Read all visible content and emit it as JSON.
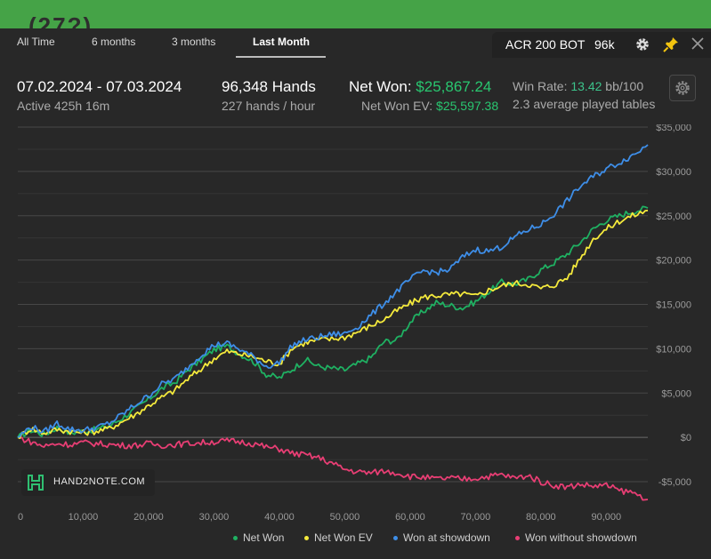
{
  "top": {
    "partial_text": "(27?)"
  },
  "tabs": [
    {
      "label": "All Time",
      "active": false
    },
    {
      "label": "6 months",
      "active": false
    },
    {
      "label": "3 months",
      "active": false
    },
    {
      "label": "Last Month",
      "active": true
    }
  ],
  "bot": {
    "name": "ACR 200 BOT",
    "hands": "96k",
    "gear": "gear-icon",
    "pin": "pin-icon",
    "close": "close-icon"
  },
  "stats": {
    "date_range": "07.02.2024 - 07.03.2024",
    "active": "Active 425h 16m",
    "hands": "96,348 Hands",
    "hands_per_hour": "227 hands / hour",
    "net_won_label": "Net Won:",
    "net_won_value": "$25,867.24",
    "net_won_ev_label": "Net Won  EV:",
    "net_won_ev_value": "$25,597.38",
    "win_rate_label": "Win Rate:",
    "win_rate_value": "13.42",
    "win_rate_unit": "bb/100",
    "tables": "2.3 average played tables"
  },
  "watermark": {
    "text": "HAND2NOTE.COM"
  },
  "colors": {
    "net_won": "#1fb162",
    "net_won_ev": "#f5ea3c",
    "showdown": "#3e8ee8",
    "no_showdown": "#e83e74",
    "header_green": "#45a347"
  },
  "chart_data": {
    "type": "line",
    "x_ticks": [
      "0",
      "10,000",
      "20,000",
      "30,000",
      "40,000",
      "50,000",
      "60,000",
      "70,000",
      "80,000",
      "90,000"
    ],
    "y_ticks": [
      "$35,000",
      "$30,000",
      "$25,000",
      "$20,000",
      "$15,000",
      "$10,000",
      "$5,000",
      "$0",
      "-$5,000"
    ],
    "xlim": [
      0,
      96348
    ],
    "ylim": [
      -7500,
      35000
    ],
    "grid": true,
    "legend_position": "bottom-right",
    "series": [
      {
        "name": "Net Won",
        "color": "#1fb162",
        "x": [
          0,
          2000,
          4000,
          6000,
          8000,
          10000,
          12000,
          14000,
          16000,
          18000,
          20000,
          22000,
          24000,
          26000,
          28000,
          30000,
          32000,
          34000,
          36000,
          38000,
          40000,
          42000,
          44000,
          46000,
          48000,
          50000,
          52000,
          54000,
          56000,
          58000,
          60000,
          62000,
          64000,
          66000,
          68000,
          70000,
          72000,
          74000,
          76000,
          78000,
          80000,
          82000,
          84000,
          86000,
          88000,
          90000,
          92000,
          94000,
          96348
        ],
        "values": [
          0,
          800,
          300,
          1100,
          500,
          700,
          900,
          1300,
          2200,
          3200,
          4300,
          5500,
          6200,
          7600,
          8700,
          9900,
          10300,
          9400,
          8600,
          7100,
          6700,
          7700,
          8800,
          8000,
          7800,
          7600,
          8300,
          9000,
          10800,
          11000,
          13000,
          14200,
          15200,
          14900,
          14600,
          15300,
          16400,
          17500,
          17300,
          17800,
          18900,
          19700,
          20700,
          22000,
          23500,
          24500,
          25000,
          25500,
          25867
        ]
      },
      {
        "name": "Net Won  EV",
        "color": "#f5ea3c",
        "x": [
          0,
          2000,
          4000,
          6000,
          8000,
          10000,
          12000,
          14000,
          16000,
          18000,
          20000,
          22000,
          24000,
          26000,
          28000,
          30000,
          32000,
          34000,
          36000,
          38000,
          40000,
          42000,
          44000,
          46000,
          48000,
          50000,
          52000,
          54000,
          56000,
          58000,
          60000,
          62000,
          64000,
          66000,
          68000,
          70000,
          72000,
          74000,
          76000,
          78000,
          80000,
          82000,
          84000,
          86000,
          88000,
          90000,
          92000,
          94000,
          96348
        ],
        "values": [
          0,
          1000,
          500,
          900,
          700,
          500,
          700,
          1000,
          1800,
          2600,
          3600,
          4500,
          5300,
          6600,
          7700,
          8900,
          9700,
          9400,
          9100,
          8600,
          8300,
          10100,
          10700,
          11000,
          11100,
          11300,
          11900,
          12600,
          13300,
          14300,
          15100,
          15800,
          16000,
          16100,
          16200,
          15900,
          16600,
          17100,
          17400,
          17300,
          16800,
          17200,
          18000,
          20200,
          22400,
          23500,
          24400,
          25000,
          25597
        ]
      },
      {
        "name": "Won at showdown",
        "color": "#3e8ee8",
        "x": [
          0,
          2000,
          4000,
          6000,
          8000,
          10000,
          12000,
          14000,
          16000,
          18000,
          20000,
          22000,
          24000,
          26000,
          28000,
          30000,
          32000,
          34000,
          36000,
          38000,
          40000,
          42000,
          44000,
          46000,
          48000,
          50000,
          52000,
          54000,
          56000,
          58000,
          60000,
          62000,
          64000,
          66000,
          68000,
          70000,
          72000,
          74000,
          76000,
          78000,
          80000,
          82000,
          84000,
          86000,
          88000,
          90000,
          92000,
          94000,
          96348
        ],
        "values": [
          0,
          1200,
          600,
          1600,
          900,
          800,
          1100,
          1600,
          2600,
          3700,
          4700,
          6000,
          6600,
          7900,
          9300,
          10400,
          10600,
          9900,
          9100,
          8000,
          8400,
          10400,
          11000,
          11300,
          11600,
          11700,
          12500,
          13800,
          15100,
          16500,
          17800,
          18800,
          18600,
          18900,
          20300,
          21200,
          21000,
          21500,
          22600,
          23400,
          24000,
          25200,
          26700,
          28300,
          29400,
          30300,
          31000,
          31800,
          33000
        ]
      },
      {
        "name": "Won without showdown",
        "color": "#e83e74",
        "x": [
          0,
          2000,
          4000,
          6000,
          8000,
          10000,
          12000,
          14000,
          16000,
          18000,
          20000,
          22000,
          24000,
          26000,
          28000,
          30000,
          32000,
          34000,
          36000,
          38000,
          40000,
          42000,
          44000,
          46000,
          48000,
          50000,
          52000,
          54000,
          56000,
          58000,
          60000,
          62000,
          64000,
          66000,
          68000,
          70000,
          72000,
          74000,
          76000,
          78000,
          80000,
          82000,
          84000,
          86000,
          88000,
          90000,
          92000,
          94000,
          96348
        ],
        "values": [
          0,
          -500,
          -1000,
          -700,
          -800,
          -600,
          -700,
          -800,
          -900,
          -900,
          -700,
          -900,
          -800,
          -700,
          -600,
          -500,
          -400,
          -500,
          -700,
          -1100,
          -1300,
          -1800,
          -2000,
          -2300,
          -2900,
          -3600,
          -3900,
          -4000,
          -3800,
          -4000,
          -4400,
          -4500,
          -4700,
          -4600,
          -4700,
          -4600,
          -4400,
          -4200,
          -4600,
          -4300,
          -5000,
          -5400,
          -5600,
          -5300,
          -5500,
          -5400,
          -6000,
          -6200,
          -7000
        ]
      }
    ]
  }
}
